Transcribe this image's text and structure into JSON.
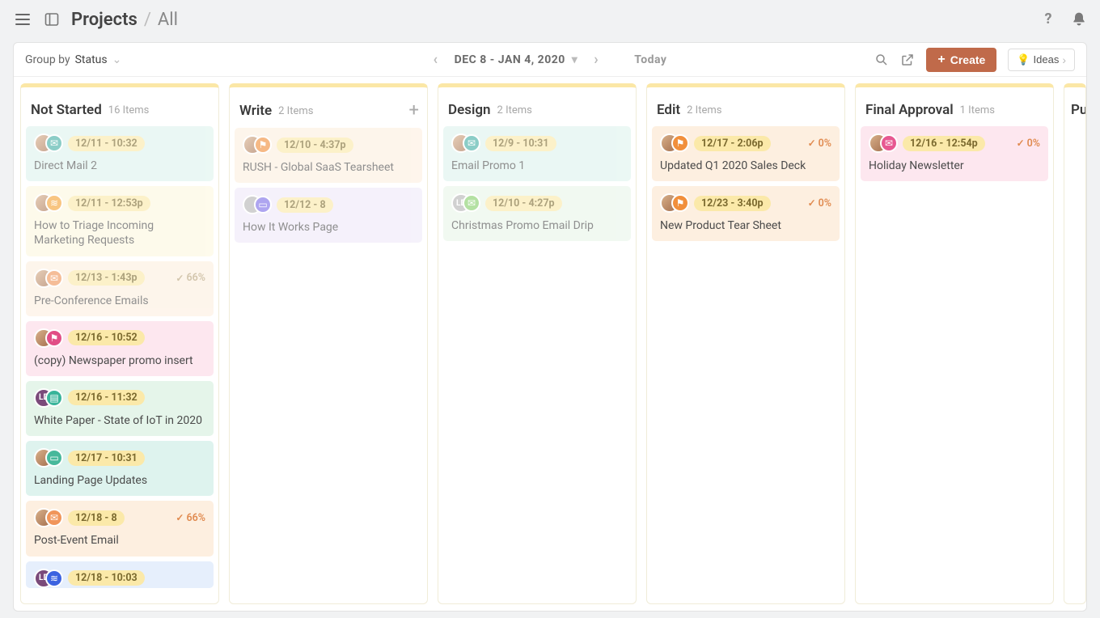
{
  "header": {
    "breadcrumb_main": "Projects",
    "breadcrumb_sep": "/",
    "breadcrumb_sub": "All"
  },
  "toolbar": {
    "groupby_label": "Group by",
    "groupby_value": "Status",
    "date_range": "DEC 8 - JAN 4, 2020",
    "today_label": "Today",
    "create_label": "Create",
    "ideas_label": "Ideas"
  },
  "columns": [
    {
      "title": "Not Started",
      "count": "16 Items"
    },
    {
      "title": "Write",
      "count": "2 Items"
    },
    {
      "title": "Design",
      "count": "2 Items"
    },
    {
      "title": "Edit",
      "count": "2 Items"
    },
    {
      "title": "Final Approval",
      "count": "1 Items"
    },
    {
      "title": "Pu",
      "count": ""
    }
  ],
  "cards": {
    "not_started": [
      {
        "date": "12/11 - 10:32",
        "title": "Direct Mail 2",
        "avatar": "photo",
        "icon": "mail",
        "bg": "teal",
        "faded": true,
        "progress": ""
      },
      {
        "date": "12/11 - 12:53p",
        "title": "How to Triage Incoming Marketing Requests",
        "avatar": "photo",
        "icon": "rss",
        "bg": "yellow",
        "faded": true,
        "progress": ""
      },
      {
        "date": "12/13 - 1:43p",
        "title": "Pre-Conference Emails",
        "avatar": "photo",
        "icon": "mail",
        "bg": "orange",
        "faded": true,
        "progress": "66%"
      },
      {
        "date": "12/16 - 10:52",
        "title": "(copy) Newspaper promo insert",
        "avatar": "photo",
        "icon": "flag-pink",
        "bg": "pink",
        "faded": false,
        "progress": ""
      },
      {
        "date": "12/16 - 11:32",
        "title": "White Paper - State of IoT in 2020",
        "avatar": "LD",
        "icon": "book",
        "bg": "green",
        "faded": false,
        "progress": ""
      },
      {
        "date": "12/17 - 10:31",
        "title": "Landing Page Updates",
        "avatar": "photo",
        "icon": "screen",
        "bg": "teal",
        "faded": false,
        "progress": ""
      },
      {
        "date": "12/18 - 8",
        "title": "Post-Event Email",
        "avatar": "photo",
        "icon": "mail-orange",
        "bg": "orange",
        "faded": false,
        "progress": "66%"
      },
      {
        "date": "12/18 - 10:03",
        "title": "",
        "avatar": "LD",
        "icon": "rss-blue",
        "bg": "blue",
        "faded": false,
        "progress": ""
      }
    ],
    "write": [
      {
        "date": "12/10 - 4:37p",
        "title": "RUSH - Global SaaS Tearsheet",
        "avatar": "photo",
        "icon": "flag",
        "bg": "orange",
        "faded": true,
        "progress": ""
      },
      {
        "date": "12/12 - 8",
        "title": "How It Works Page",
        "avatar": "gray",
        "icon": "screen-purple",
        "bg": "purple",
        "faded": true,
        "progress": ""
      }
    ],
    "design": [
      {
        "date": "12/9 - 10:31",
        "title": "Email Promo 1",
        "avatar": "photo",
        "icon": "mail",
        "bg": "teal",
        "faded": true,
        "progress": ""
      },
      {
        "date": "12/10 - 4:27p",
        "title": "Christmas Promo Email Drip",
        "avatar": "LD-gray",
        "icon": "mail-green",
        "bg": "green2",
        "faded": true,
        "progress": ""
      }
    ],
    "edit": [
      {
        "date": "12/17 - 2:06p",
        "title": "Updated Q1 2020 Sales Deck",
        "avatar": "photo",
        "icon": "flag",
        "bg": "orange",
        "faded": false,
        "progress": "0%"
      },
      {
        "date": "12/23 - 3:40p",
        "title": "New Product Tear Sheet",
        "avatar": "photo",
        "icon": "flag",
        "bg": "orange",
        "faded": false,
        "progress": "0%"
      }
    ],
    "final_approval": [
      {
        "date": "12/16 - 12:54p",
        "title": "Holiday Newsletter",
        "avatar": "photo",
        "icon": "mail-pink",
        "bg": "pink",
        "faded": false,
        "progress": "0%"
      }
    ]
  },
  "icons": {
    "mail": "✉",
    "rss": "∿",
    "flag": "⚑",
    "book": "▤",
    "screen": "▭",
    "check": "✓"
  }
}
